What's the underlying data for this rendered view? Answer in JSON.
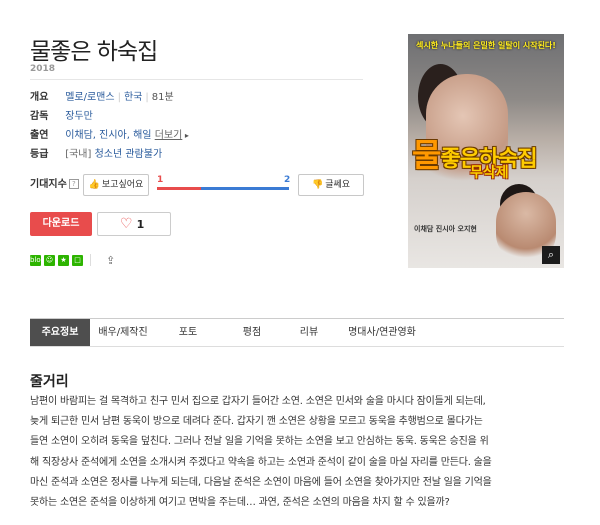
{
  "movie": {
    "title": "물좋은 하숙집",
    "year": "2018"
  },
  "info": {
    "overview_label": "개요",
    "genre": "멜로/로맨스",
    "country": "한국",
    "runtime": "81분",
    "director_label": "감독",
    "director": "장두만",
    "cast_label": "출연",
    "cast": "이채담, 진시아, 해일",
    "more": "더보기",
    "rating_label": "등급",
    "rating_prefix": "[국내]",
    "rating": "청소년 관람불가"
  },
  "expect": {
    "label": "기대지수",
    "help": "?",
    "want_button": "보고싶어요",
    "want_count": "1",
    "meh_count": "2",
    "meh_button": "글쎄요",
    "want_fraction": 0.333
  },
  "actions": {
    "download": "다운로드",
    "like_count": "1"
  },
  "share": {
    "blog": "blog"
  },
  "poster": {
    "tagline": "섹시한 누나들의 은밀한 일탈이 시작된다!",
    "title_first": "물",
    "title_rest": "좋은하숙집",
    "subtitle": "무삭제",
    "credits": "이채담  진시아  오지현"
  },
  "tabs": [
    "주요정보",
    "배우/제작진",
    "포토",
    "평점",
    "리뷰",
    "명대사/연관영화"
  ],
  "synopsis": {
    "heading": "줄거리",
    "lines": [
      "남편이 바람피는 걸 목격하고 친구 민서 집으로 갑자기 들어간 소연. 소연은 민서와 술을 마시다 잠이들게 되는데,",
      "늦게 퇴근한 민서 남편 동욱이 방으로 데려다 준다. 갑자기 깬 소연은 상황을 모르고 동욱을 추행범으로 몰다가는",
      "들연 소연이 오히려 동욱을 덮친다. 그러나 전날 일을 기억을 못하는 소연을 보고 안심하는 동욱. 동욱은 승진을 위",
      "해 직장상사 준석에게 소연을 소개시켜 주겠다고 약속을 하고는 소연과 준석이 같이 술을 마실 자리를 만든다. 술을",
      "마신 준석과 소연은 정사를 나누게 되는데, 다음날 준석은 소연이 마음에 들어 소연을 찾아가지만 전날 일을 기억을",
      "못하는 소연은 준석을 이상하게 여기고 면박을 주는데… 과연, 준석은 소연의 마음을 차지 할 수 있을까?"
    ]
  }
}
